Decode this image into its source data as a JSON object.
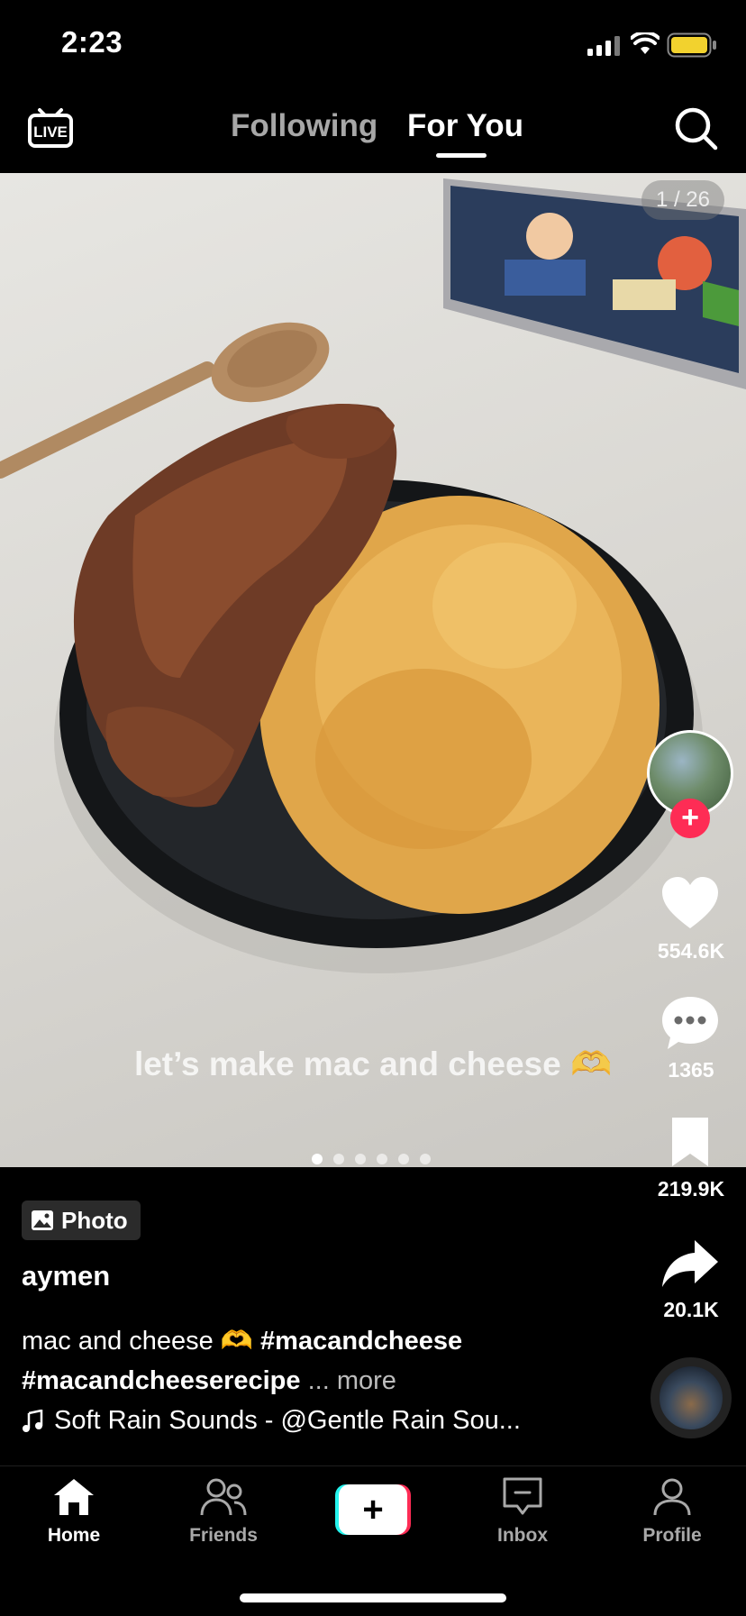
{
  "status_bar": {
    "time": "2:23"
  },
  "top_nav": {
    "live_label": "LIVE",
    "tabs": [
      {
        "label": "Following",
        "active": false
      },
      {
        "label": "For You",
        "active": true
      }
    ]
  },
  "post": {
    "photo_counter": "1 / 26",
    "overlay_caption": "let’s make mac and cheese 🫶",
    "pagination": {
      "count": 6,
      "active_index": 0
    },
    "badge_label": "Photo",
    "username": "aymen",
    "caption_text": "mac and cheese 🫶",
    "hashtags": [
      "#macandcheese",
      "#macandcheeserecipe"
    ],
    "more_label": "... more",
    "sound": "Soft Rain Sounds - @Gentle Rain Sou..."
  },
  "rail": {
    "likes": "554.6K",
    "comments": "1365",
    "bookmarks": "219.9K",
    "shares": "20.1K",
    "follow_label": "+"
  },
  "tab_bar": {
    "home": "Home",
    "friends": "Friends",
    "create": "+",
    "inbox": "Inbox",
    "profile": "Profile"
  },
  "colors": {
    "accent": "#fe2c55",
    "cyan": "#25f4ee"
  }
}
